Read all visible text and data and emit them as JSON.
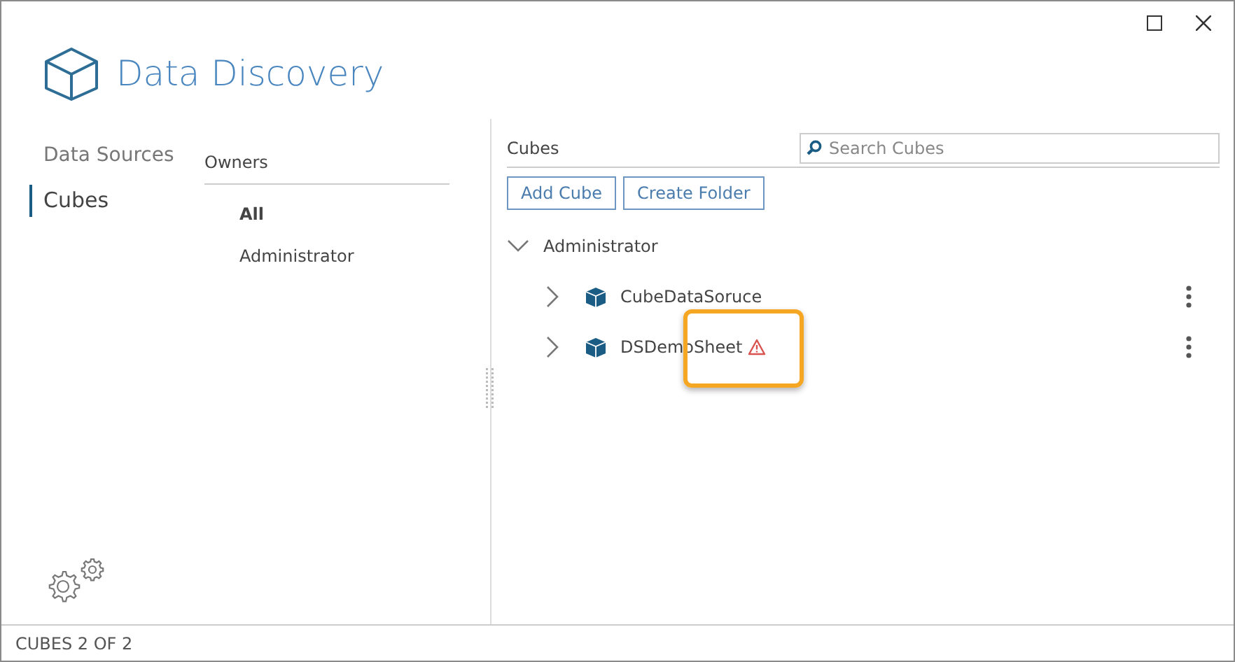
{
  "window": {
    "title": "Data Discovery"
  },
  "nav": [
    {
      "label": "Data Sources",
      "selected": false
    },
    {
      "label": "Cubes",
      "selected": true
    }
  ],
  "owners": {
    "heading": "Owners",
    "items": [
      {
        "label": "All",
        "selected": true
      },
      {
        "label": "Administrator",
        "selected": false
      }
    ]
  },
  "cubes": {
    "heading": "Cubes",
    "search": {
      "placeholder": "Search Cubes"
    },
    "buttons": [
      "Add Cube",
      "Create Folder"
    ],
    "tree": [
      {
        "label": "Administrator",
        "expanded": true,
        "children": [
          {
            "label": "CubeDataSoruce",
            "expanded": false,
            "warning": false,
            "highlighted": false
          },
          {
            "label": "DSDemoSheet",
            "expanded": false,
            "warning": true,
            "highlighted": true
          }
        ]
      }
    ]
  },
  "status_bar": "CUBES 2 OF 2"
}
